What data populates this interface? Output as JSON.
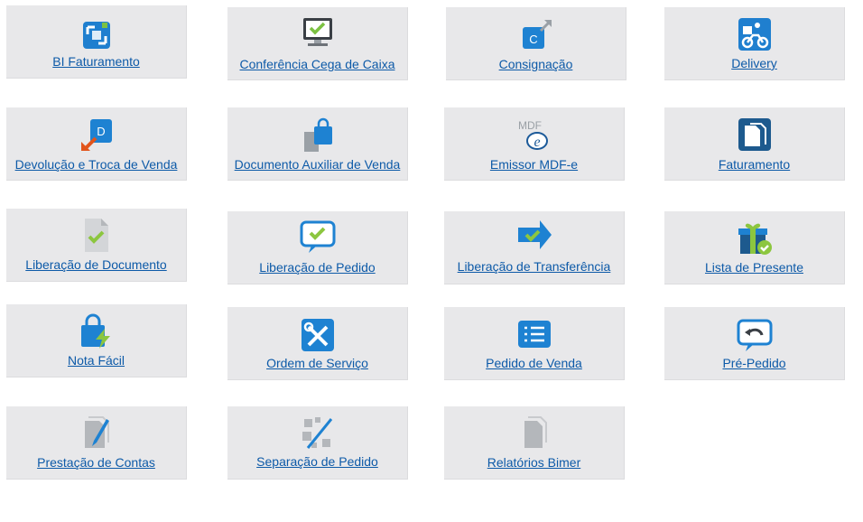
{
  "tiles": [
    {
      "label": "BI Faturamento",
      "icon": "bi-chart-icon"
    },
    {
      "label": "Conferência Cega de Caixa",
      "icon": "monitor-check-icon"
    },
    {
      "label": "Consignação",
      "icon": "consignment-icon"
    },
    {
      "label": "Delivery",
      "icon": "delivery-bike-icon"
    },
    {
      "label": "Devolução e Troca de Venda",
      "icon": "return-arrow-icon"
    },
    {
      "label": "Documento Auxiliar de Venda",
      "icon": "shopping-bag-doc-icon"
    },
    {
      "label": "Emissor MDF-e",
      "icon": "mdfe-icon"
    },
    {
      "label": "Faturamento",
      "icon": "invoice-docs-icon"
    },
    {
      "label": "Liberação de Documento",
      "icon": "document-check-icon"
    },
    {
      "label": "Liberação de Pedido",
      "icon": "speech-check-icon"
    },
    {
      "label": "Liberação de Transferência",
      "icon": "arrow-check-icon"
    },
    {
      "label": "Lista de Presente",
      "icon": "gift-check-icon"
    },
    {
      "label": "Nota Fácil",
      "icon": "bag-lightning-icon"
    },
    {
      "label": "Ordem de Serviço",
      "icon": "tools-icon"
    },
    {
      "label": "Pedido de Venda",
      "icon": "list-icon"
    },
    {
      "label": "Pré-Pedido",
      "icon": "speech-undo-icon"
    },
    {
      "label": "Prestação de Contas",
      "icon": "docs-pen-icon"
    },
    {
      "label": "Separação de Pedido",
      "icon": "separation-icon"
    },
    {
      "label": "Relatórios Bimer",
      "icon": "reports-icon"
    }
  ]
}
